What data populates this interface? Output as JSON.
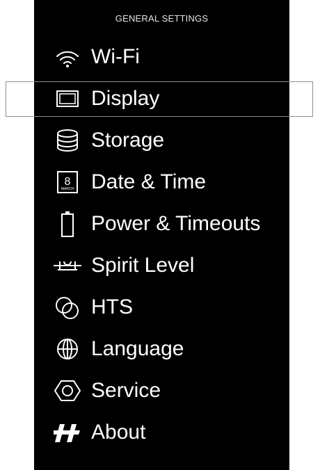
{
  "screen": {
    "title": "GENERAL SETTINGS",
    "selected_item": "Display"
  },
  "menu": {
    "items": [
      {
        "label": "Wi-Fi",
        "icon": "wifi-icon"
      },
      {
        "label": "Display",
        "icon": "display-icon"
      },
      {
        "label": "Storage",
        "icon": "storage-icon"
      },
      {
        "label": "Date & Time",
        "icon": "calendar-icon",
        "icon_text": [
          "8",
          "MARCH"
        ]
      },
      {
        "label": "Power & Timeouts",
        "icon": "battery-icon"
      },
      {
        "label": "Spirit Level",
        "icon": "spirit-level-icon"
      },
      {
        "label": "HTS",
        "icon": "hts-icon"
      },
      {
        "label": "Language",
        "icon": "globe-icon"
      },
      {
        "label": "Service",
        "icon": "hexagon-icon"
      },
      {
        "label": "About",
        "icon": "hasselblad-logo-icon"
      }
    ]
  },
  "colors": {
    "background": "#000000",
    "text": "#ffffff",
    "selection_border": "#8e8e8e"
  }
}
